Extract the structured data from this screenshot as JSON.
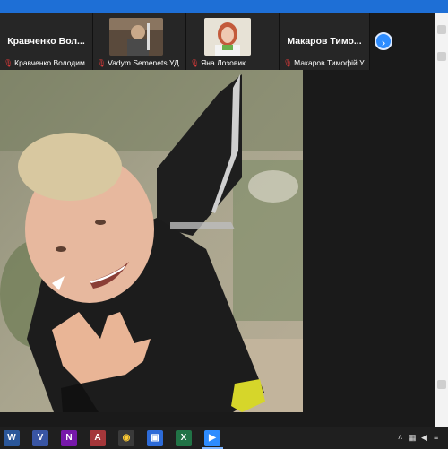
{
  "participants": [
    {
      "display_name": "Кравченко Вол...",
      "label": "Кравченко Володим...",
      "video": false
    },
    {
      "display_name": "",
      "label": "Vadym Semenets УД...",
      "video": true
    },
    {
      "display_name": "",
      "label": "Яна Лозовик",
      "video": true
    },
    {
      "display_name": "Макаров Тимо...",
      "label": "Макаров Тимофій У...",
      "video": false
    }
  ],
  "gallery_next_icon": "chevron-right-icon",
  "mic_icon": "mic-muted-icon",
  "taskbar": {
    "apps": [
      {
        "name": "word",
        "glyph": "W",
        "color": "#2b579a"
      },
      {
        "name": "visio",
        "glyph": "V",
        "color": "#3955a3"
      },
      {
        "name": "onenote",
        "glyph": "N",
        "color": "#7719aa"
      },
      {
        "name": "access",
        "glyph": "A",
        "color": "#a4373a"
      },
      {
        "name": "chrome",
        "glyph": "◉",
        "color": "#3a3a3a"
      },
      {
        "name": "floppy",
        "glyph": "▣",
        "color": "#2d6bd8"
      },
      {
        "name": "excel",
        "glyph": "X",
        "color": "#217346"
      },
      {
        "name": "zoom",
        "glyph": "▶",
        "color": "#2d8cff"
      }
    ],
    "tray_icons": [
      "caret-up-icon",
      "network-icon",
      "volume-icon",
      "language-icon"
    ]
  }
}
